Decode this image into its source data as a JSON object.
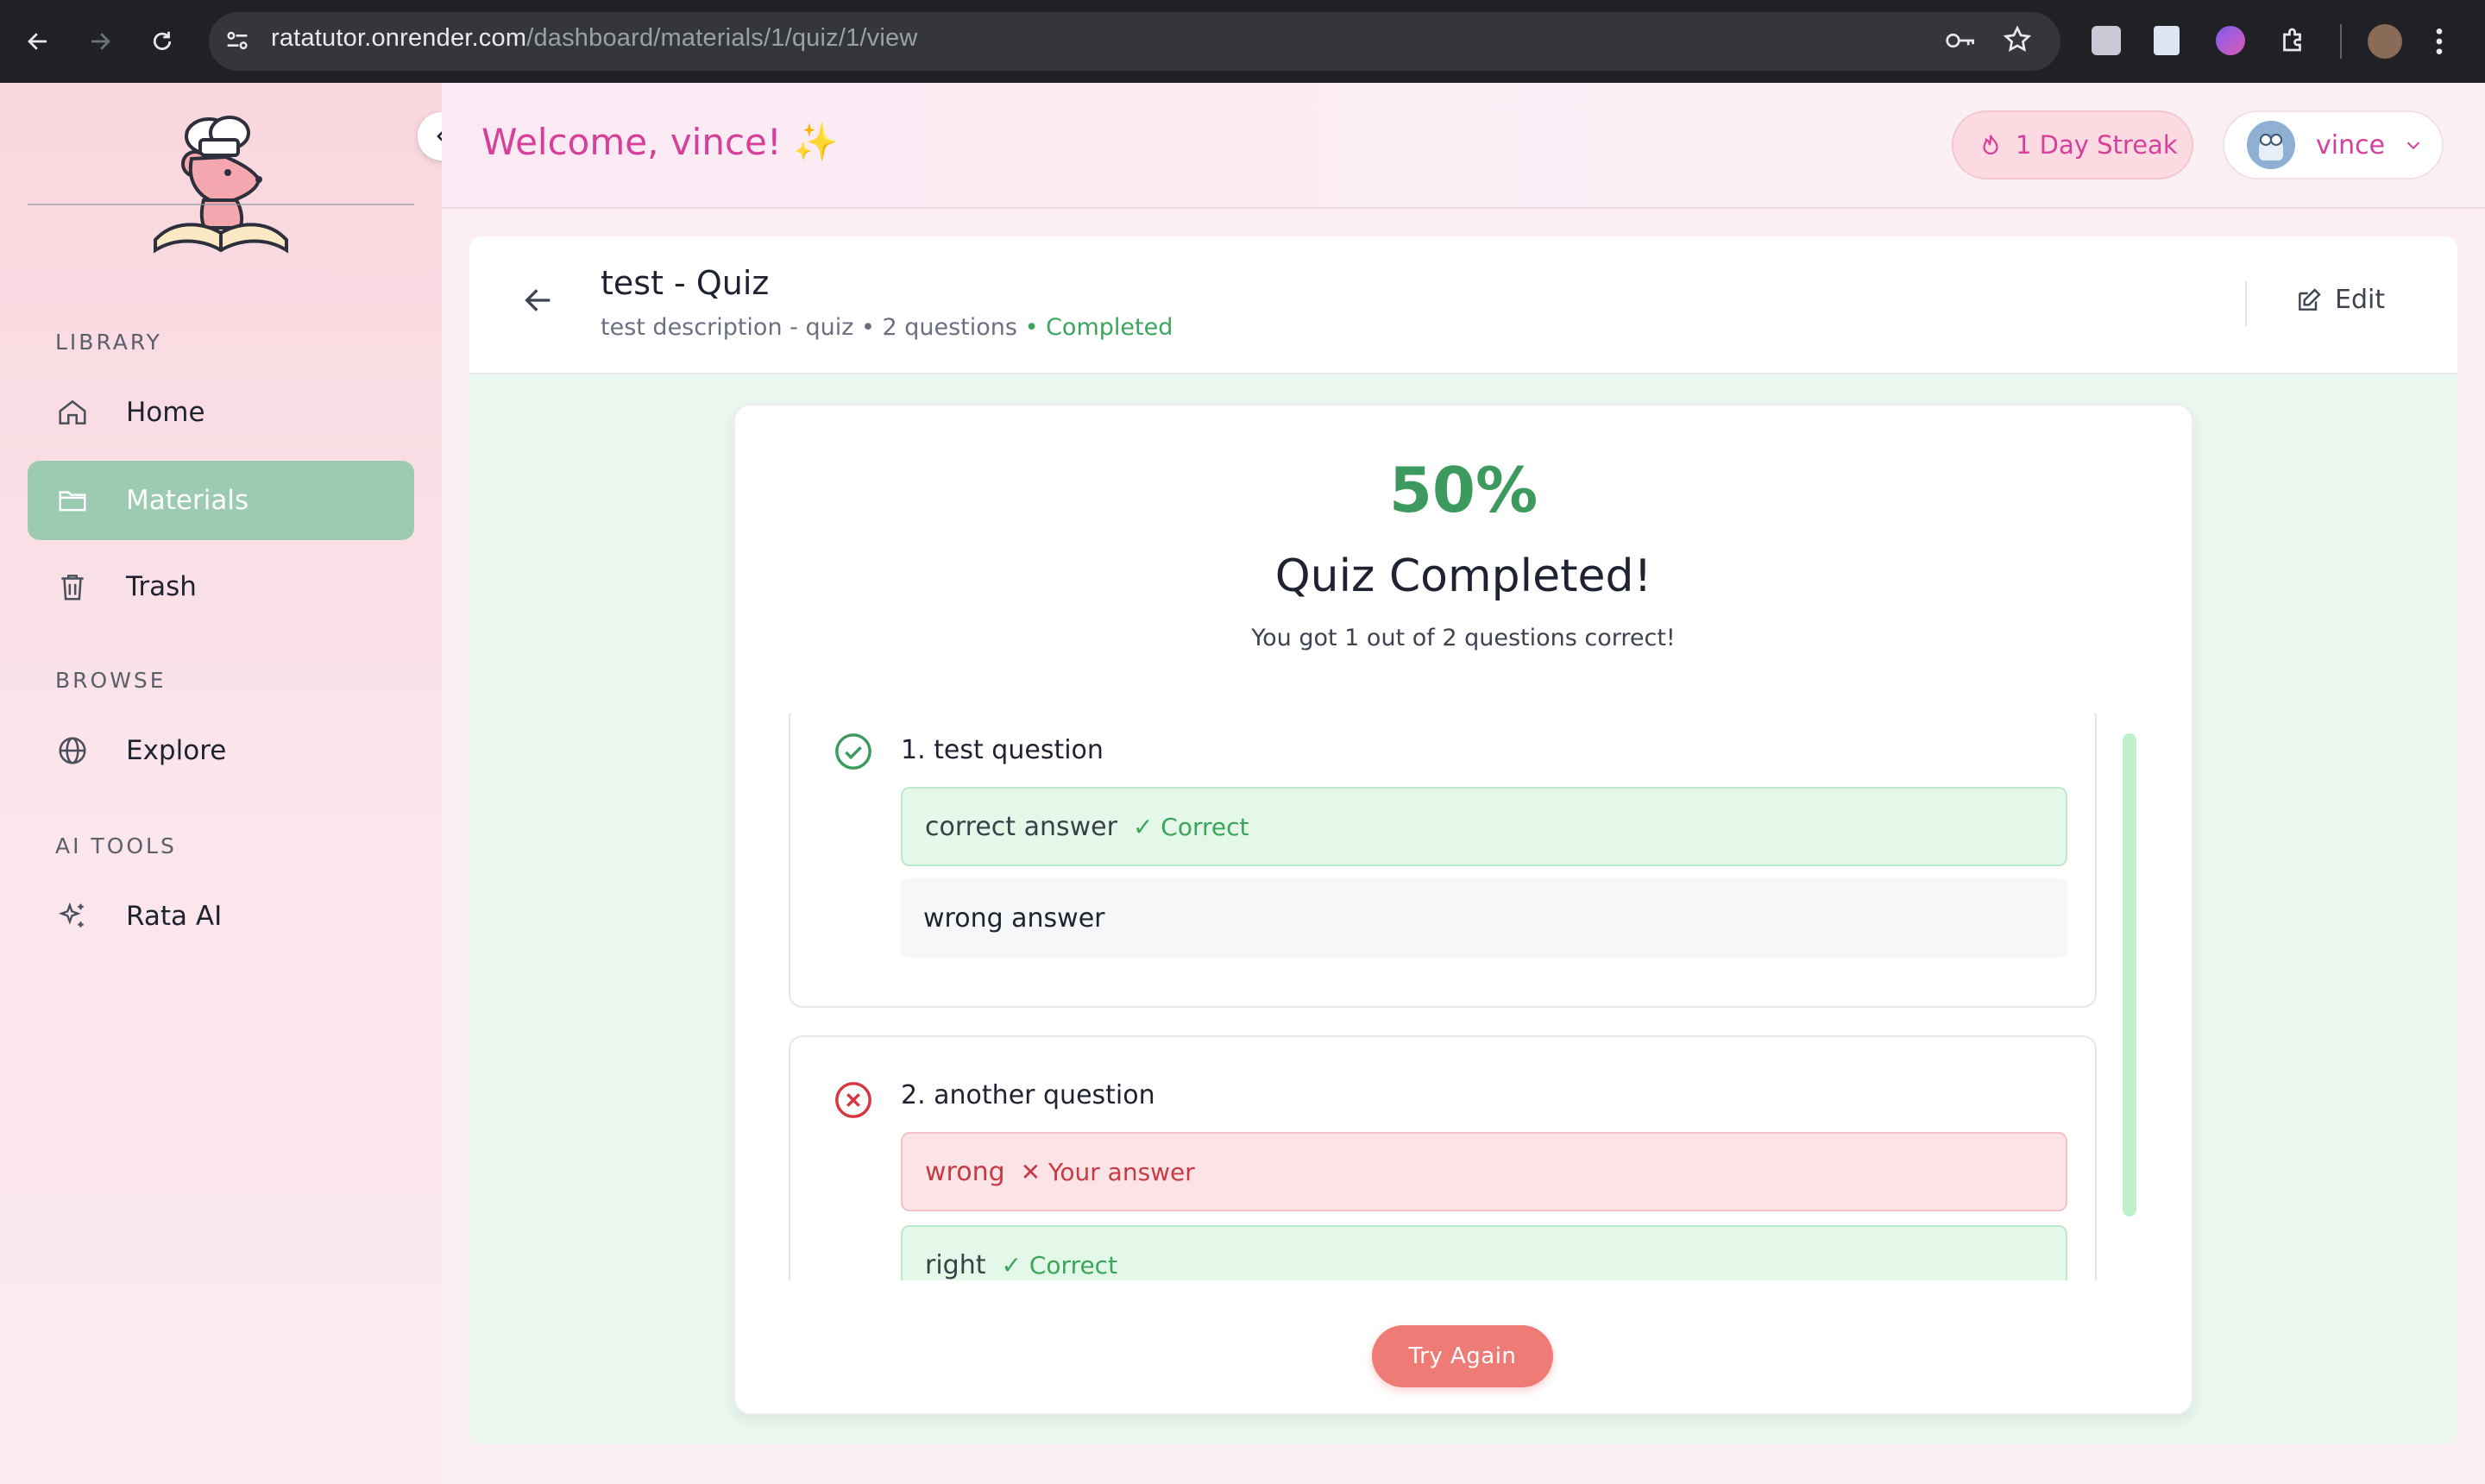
{
  "browser": {
    "url_host": "ratatutor.onrender.com",
    "url_path": "/dashboard/materials/1/quiz/1/view"
  },
  "sidebar": {
    "sections": [
      {
        "label": "LIBRARY"
      },
      {
        "label": "BROWSE"
      },
      {
        "label": "AI TOOLS"
      }
    ],
    "items": [
      {
        "label": "Home",
        "icon": "home-icon",
        "active": false
      },
      {
        "label": "Materials",
        "icon": "folder-icon",
        "active": true
      },
      {
        "label": "Trash",
        "icon": "trash-icon",
        "active": false
      },
      {
        "label": "Explore",
        "icon": "globe-icon",
        "active": false
      },
      {
        "label": "Rata AI",
        "icon": "sparkles-icon",
        "active": false
      }
    ]
  },
  "header": {
    "welcome": "Welcome, vince! ✨",
    "streak": "1 Day Streak",
    "username": "vince"
  },
  "quiz": {
    "title": "test - Quiz",
    "meta": "test description - quiz • 2 questions",
    "status": "• Completed",
    "edit_label": "Edit"
  },
  "result": {
    "score": "50%",
    "heading": "Quiz Completed!",
    "summary": "You got 1 out of 2 questions correct!"
  },
  "questions": [
    {
      "title": "1. test question",
      "status": "correct",
      "options": [
        {
          "text": "correct answer",
          "tag": "✓ Correct",
          "state": "correct"
        },
        {
          "text": "wrong answer",
          "tag": "",
          "state": "neutral"
        }
      ]
    },
    {
      "title": "2. another question",
      "status": "wrong",
      "options": [
        {
          "text": "wrong",
          "tag": "✕ Your answer",
          "state": "wrong"
        },
        {
          "text": "right",
          "tag": "✓ Correct",
          "state": "correct"
        }
      ]
    }
  ],
  "actions": {
    "try_again": "Try Again"
  },
  "colors": {
    "accent_pink": "#d6409a",
    "active_green": "#9ccbb2",
    "score_green": "#3c9a5e",
    "wrong_red": "#c83a44",
    "button_coral": "#ee7b76"
  }
}
